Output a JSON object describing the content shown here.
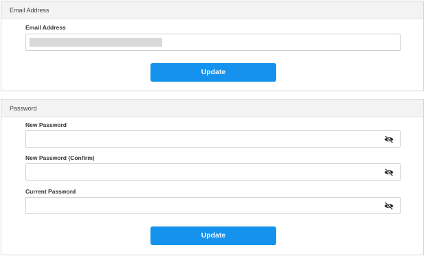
{
  "email_section": {
    "header": "Email Address",
    "field_label": "Email Address",
    "field_value": "",
    "update_button": "Update"
  },
  "password_section": {
    "header": "Password",
    "fields": [
      {
        "label": "New Password",
        "value": "",
        "icon": "eye-slash-icon"
      },
      {
        "label": "New Password (Confirm)",
        "value": "",
        "icon": "eye-slash-icon"
      },
      {
        "label": "Current Password",
        "value": "",
        "icon": "eye-slash-icon"
      }
    ],
    "update_button": "Update"
  },
  "colors": {
    "button": "#1492ee",
    "panel_header_bg": "#f3f3f3",
    "border": "#d5d5d5"
  }
}
